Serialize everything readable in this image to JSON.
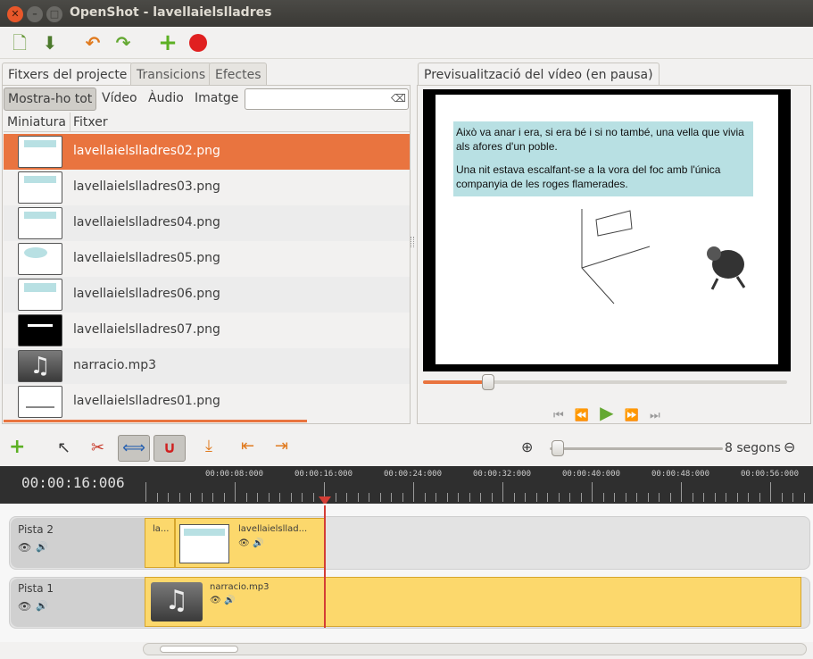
{
  "window": {
    "title": "OpenShot - lavellaielslladres"
  },
  "left_tabs": [
    "Fitxers del projecte",
    "Transicions",
    "Efectes"
  ],
  "filters": {
    "show_all": "Mostra-ho tot",
    "video": "Vídeo",
    "audio": "Àudio",
    "image": "Imatge",
    "search_placeholder": ""
  },
  "columns": {
    "thumb": "Miniatura",
    "file": "Fitxer"
  },
  "files": [
    {
      "name": "lavellaielslladres02.png",
      "type": "image-text"
    },
    {
      "name": "lavellaielslladres03.png",
      "type": "image-text"
    },
    {
      "name": "lavellaielslladres04.png",
      "type": "image-text"
    },
    {
      "name": "lavellaielslladres05.png",
      "type": "image-bubble"
    },
    {
      "name": "lavellaielslladres06.png",
      "type": "image-text"
    },
    {
      "name": "lavellaielslladres07.png",
      "type": "image-black"
    },
    {
      "name": "narracio.mp3",
      "type": "audio"
    },
    {
      "name": "lavellaielslladres01.png",
      "type": "image-title"
    }
  ],
  "preview": {
    "tab": "Previsualització del vídeo (en pausa)",
    "paragraph1": "Això va anar i era, si era bé i si no també, una vella que vivia als afores d'un poble.",
    "paragraph2": "Una nit estava escalfant-se a la vora del foc amb l'única companyia de les roges flamerades.",
    "progress": 0.18
  },
  "timeline": {
    "zoom_label": "8 segons",
    "current_time": "00:00:16:006",
    "ticks": [
      "00:00:08:000",
      "00:00:16:000",
      "00:00:24:000",
      "00:00:32:000",
      "00:00:40:000",
      "00:00:48:000",
      "00:00:56:000"
    ],
    "tracks": [
      {
        "name": "Pista 2",
        "clips": [
          {
            "label": "la..."
          },
          {
            "label": "lavellaielsllad..."
          }
        ]
      },
      {
        "name": "Pista 1",
        "clips": [
          {
            "label": "narracio.mp3"
          }
        ]
      }
    ]
  },
  "colors": {
    "accent": "#e9743f",
    "clip": "#fcd86c",
    "playhead": "#d43d35",
    "timeline_bg": "#2f2f2f"
  }
}
